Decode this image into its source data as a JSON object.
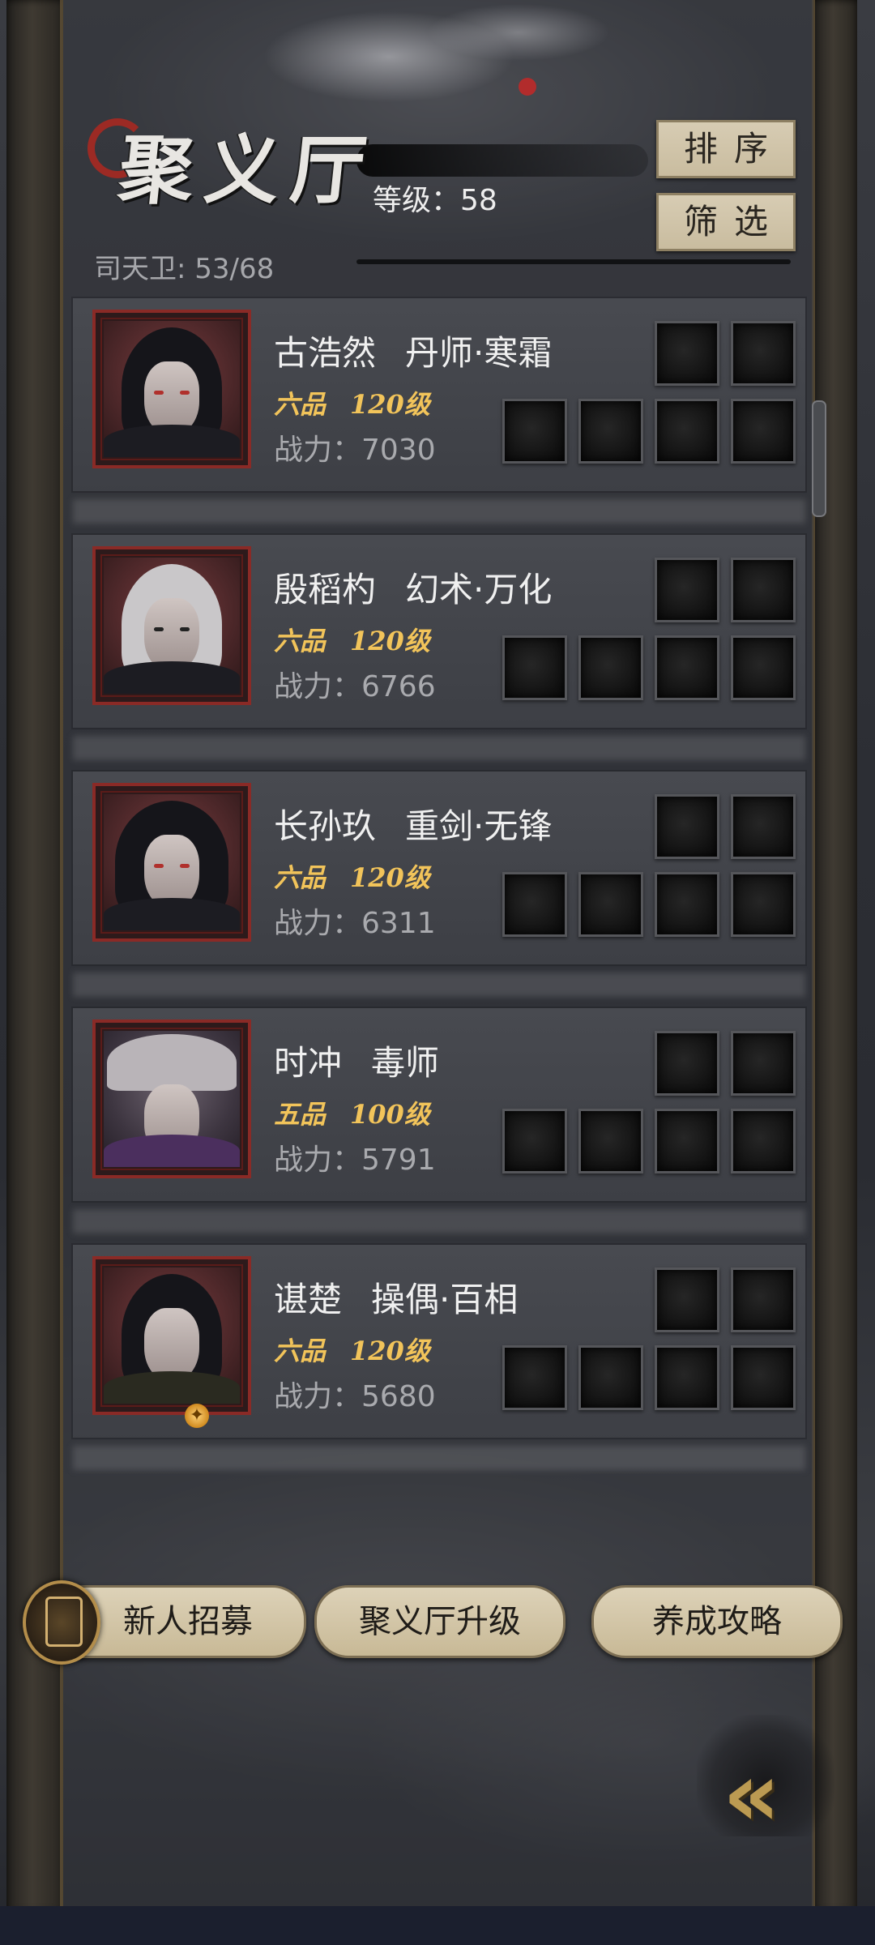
{
  "header": {
    "title": "聚义厅",
    "level_label": "等级：",
    "level_value": "58",
    "guard_label": "司天卫: 53/68",
    "sort_label": "排序",
    "filter_label": "筛选"
  },
  "heroes": [
    {
      "name": "古浩然",
      "class": "丹师·寒霜",
      "rank": "六品",
      "level": "120级",
      "power": "战力：7030"
    },
    {
      "name": "殷稻杓",
      "class": "幻术·万化",
      "rank": "六品",
      "level": "120级",
      "power": "战力：6766"
    },
    {
      "name": "长孙玖",
      "class": "重剑·无锋",
      "rank": "六品",
      "level": "120级",
      "power": "战力：6311"
    },
    {
      "name": "时冲",
      "class": "毒师",
      "rank": "五品",
      "level": "100级",
      "power": "战力：5791"
    },
    {
      "name": "谌楚",
      "class": "操偶·百相",
      "rank": "六品",
      "level": "120级",
      "power": "战力：5680"
    }
  ],
  "bottom": {
    "recruit_label": "新人招募",
    "upgrade_label": "聚义厅升级",
    "guide_label": "养成攻略"
  },
  "icons": {
    "back": "double-chevron-left-icon",
    "recruit": "recruit-token-icon",
    "badge": "flame-badge-icon"
  },
  "colors": {
    "rank_gold": "#f2c45a",
    "frame_red": "#8a2a26",
    "button_tan": "#d7ccb3"
  }
}
